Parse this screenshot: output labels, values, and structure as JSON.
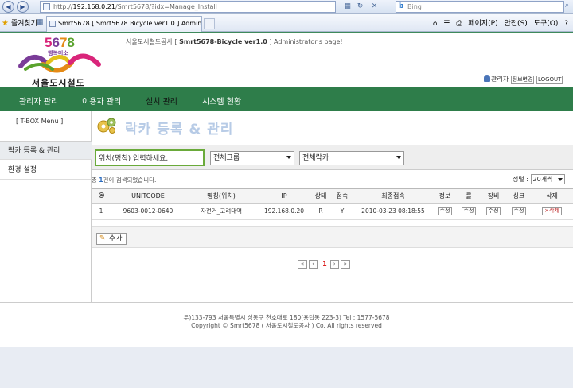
{
  "browser": {
    "url_prefix": "http://",
    "url_host": "192.168.0.21",
    "url_path": "/Smrt5678/?idx=Manage_Install",
    "search_placeholder": "Bing",
    "search_brand": "b",
    "favorites_label": "즐겨찾기",
    "tab_title": "Smrt5678 [ Smrt5678 Bicycle ver1.0 ] Adminis...",
    "menu_page": "페이지(P)",
    "menu_safety": "안전(S)",
    "menu_tools": "도구(O)",
    "nav_back_glyph": "◀",
    "nav_fwd_glyph": "▶"
  },
  "site": {
    "logo_digits": [
      "5",
      "6",
      "7",
      "8"
    ],
    "logo_tagline": "행복미소",
    "logo_name": "서울도시철도",
    "title_prefix": "서울도시철도공사 [ ",
    "title_system": "Smrt5678-Bicycle ver1.0",
    "title_suffix": " ] Administrator's page!",
    "admin_label": "관리자",
    "edit_info_label": "정보변경",
    "logout_label": "LOGOUT"
  },
  "nav": {
    "items": [
      {
        "label": "관리자 관리",
        "active": false
      },
      {
        "label": "이용자 관리",
        "active": false
      },
      {
        "label": "설치 관리",
        "active": true
      },
      {
        "label": "시스템 현황",
        "active": false
      }
    ]
  },
  "sidebar": {
    "title": "[ T-BOX Menu ]",
    "items": [
      {
        "label": "락카 등록 & 관리",
        "active": true
      },
      {
        "label": "환경 설정",
        "active": false
      }
    ]
  },
  "content": {
    "heading": "락카 등록 & 관리",
    "filter": {
      "search_placeholder": "위치(명칭) 입력하세요.",
      "group_select": "전체그룹",
      "locker_select": "전체락카"
    },
    "count_prefix": "총 ",
    "count_value": "1",
    "count_suffix": "건이 검색되었습니다.",
    "sort_label": "정렬 :",
    "sort_value": "20개씩",
    "table": {
      "headers": [
        "",
        "UNITCODE",
        "명칭(위치)",
        "IP",
        "상태",
        "접속",
        "최종접속",
        "정보",
        "룰",
        "장비",
        "싱크",
        "삭제"
      ],
      "rows": [
        {
          "no": "1",
          "unitcode": "9603-0012-0640",
          "name": "자전거_고려대역",
          "ip": "192.168.0.20",
          "status": "R",
          "connected": "Y",
          "last_access": "2010-03-23 08:18:55",
          "btn_info": "수정",
          "btn_rule": "수정",
          "btn_device": "수정",
          "btn_sync": "수정",
          "btn_delete": "×삭제"
        }
      ]
    },
    "add_label": "추가",
    "pager": {
      "first": "«",
      "prev": "‹",
      "current": "1",
      "next": "›",
      "last": "»"
    }
  },
  "footer": {
    "line1": "우)133-793 서울특별시 성동구 천호대로 180(용답동 223-3) Tel : 1577-5678",
    "line2": "Copyright © Smrt5678 ( 서울도시철도공사 ) Co. All rights reserved"
  },
  "colors": {
    "nav_green": "#2e7d4a",
    "input_border": "#6aaa3a",
    "heading_blue": "#b7cbe6"
  }
}
